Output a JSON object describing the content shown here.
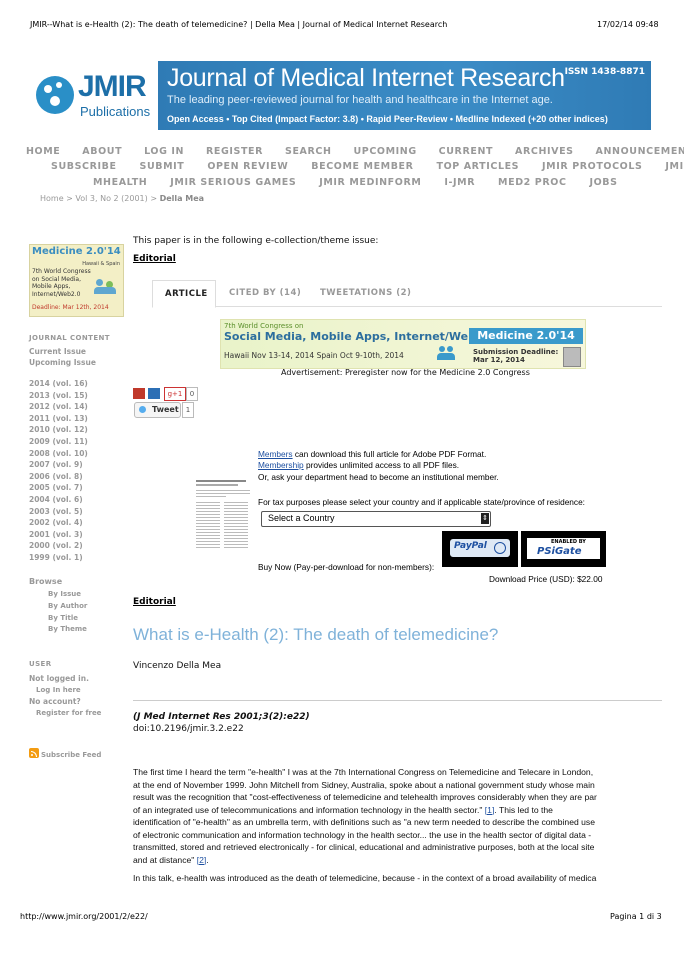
{
  "print_header": {
    "title": "JMIR--What is e-Health (2): The death of telemedicine? | Della Mea | Journal of Medical Internet Research",
    "datetime": "17/02/14 09:48"
  },
  "logo": {
    "name": "JMIR",
    "sub": "Publications"
  },
  "banner": {
    "title": "Journal of Medical Internet Research",
    "issn": "ISSN 1438-8871",
    "subtitle": "The leading peer-reviewed journal for health and healthcare in the Internet age.",
    "features": "Open Access  •  Top Cited (Impact Factor: 3.8)  •  Rapid Peer-Review  •  Medline Indexed (+20 other indices)"
  },
  "nav": {
    "row1": [
      "HOME",
      "ABOUT",
      "LOG IN",
      "REGISTER",
      "SEARCH",
      "UPCOMING",
      "CURRENT",
      "ARCHIVES",
      "ANNOUNCEMENTS"
    ],
    "row2": [
      "SUBSCRIBE",
      "SUBMIT",
      "OPEN REVIEW",
      "BECOME MEMBER",
      "TOP ARTICLES",
      "JMIR PROTOCOLS",
      "JMIR"
    ],
    "row3": [
      "MHEALTH",
      "JMIR SERIOUS GAMES",
      "JMIR MEDINFORM",
      "I-JMR",
      "MED2 PROC",
      "JOBS"
    ]
  },
  "breadcrumb": {
    "home": "Home",
    "sep": ">",
    "issue": "Vol 3, No 2 (2001)",
    "current": "Della Mea"
  },
  "side_ad": {
    "title": "Medicine 2.0'14",
    "line1": "Hawaii & Spain",
    "body": "7th World Congress on Social Media, Mobile Apps, Internet/Web2.0",
    "deadline": "Deadline: Mar 12th, 2014"
  },
  "sidebar": {
    "journal_content": "JOURNAL CONTENT",
    "current_issue": "Current Issue",
    "upcoming_issue": "Upcoming Issue",
    "years": [
      "2014 (vol. 16)",
      "2013 (vol. 15)",
      "2012 (vol. 14)",
      "2011 (vol. 13)",
      "2010 (vol. 12)",
      "2009 (vol. 11)",
      "2008 (vol. 10)",
      "2007 (vol. 9)",
      "2006 (vol. 8)",
      "2005 (vol. 7)",
      "2004 (vol. 6)",
      "2003 (vol. 5)",
      "2002 (vol. 4)",
      "2001 (vol. 3)",
      "2000 (vol. 2)",
      "1999 (vol. 1)"
    ],
    "browse": "Browse",
    "browse_items": [
      "By Issue",
      "By Author",
      "By Title",
      "By Theme"
    ],
    "user": "USER",
    "not_logged": "Not logged in.",
    "login": "Log In here",
    "no_account": "No account?",
    "register": "Register for free",
    "subscribe_feed": "Subscribe Feed"
  },
  "main": {
    "collection_note": "This paper is in the following e-collection/theme issue:",
    "collection_link": "Editorial",
    "tabs": [
      "ARTICLE",
      "CITED BY (14)",
      "TWEETATIONS (2)"
    ],
    "ad": {
      "top": "7th World Congress on",
      "headline": "Social Media, Mobile Apps, Internet/Web2.0",
      "brand": "Medicine 2.0'14",
      "locations": "Hawaii Nov 13-14, 2014  Spain Oct 9-10th, 2014",
      "deadline_label": "Submission Deadline:",
      "deadline": "Mar 12, 2014",
      "caption": "Advertisement: Preregister now for the Medicine 2.0 Congress"
    },
    "share": {
      "gplus": "g+1",
      "gplus_count": "0",
      "tweet": "Tweet",
      "tweet_count": "1"
    },
    "purchase": {
      "members_link": "Members",
      "members_text": " can download this full article for Adobe PDF Format.",
      "membership_link": "Membership",
      "membership_text": " provides unlimited access to all PDF files.",
      "dept": "Or, ask your department head to become an institutional member.",
      "tax": "For tax purposes please select your country and if applicable state/province of residence:",
      "country_placeholder": "Select a Country",
      "paypal": "PayPal",
      "psigate_top": "ENABLED BY",
      "psigate": "PSiGate",
      "buy_now": "Buy Now (Pay-per-download for non-members):",
      "price": "Download Price (USD): $22.00"
    },
    "section": "Editorial",
    "title": "What is e-Health (2): The death of telemedicine?",
    "author": "Vincenzo Della Mea",
    "citation": "(J Med Internet Res 2001;3(2):e22)",
    "doi": "doi:10.2196/jmir.3.2.e22",
    "para1": [
      "The first time I heard the term \"e-health\" I was at the 7th International Congress on Telemedicine and Telecare in London,",
      "at the end of November 1999. John Mitchell from Sidney, Australia, spoke about a national government study whose main",
      "result was the recognition that \"cost-effectiveness of telemedicine and telehealth improves considerably when they are par",
      "of an integrated use of telecommunications and information technology in the health sector.\" ",
      "identification of \"e-health\" as an umbrella term, with definitions such as \"a new term needed to describe the combined use",
      "of electronic communication and information technology in the health sector... the use in the health sector of digital data -",
      "transmitted, stored and retrieved electronically - for clinical, educational and administrative purposes, both at the local site",
      "and at distance\" "
    ],
    "ref1": "[1]",
    "ref1_tail": ". This led to the",
    "ref2": "[2]",
    "ref2_tail": ".",
    "para2": "In this talk, e-health was introduced as the death of telemedicine, because - in the context of a broad availability of medica"
  },
  "print_footer": {
    "url": "http://www.jmir.org/2001/2/e22/",
    "page": "Pagina 1 di 3"
  }
}
